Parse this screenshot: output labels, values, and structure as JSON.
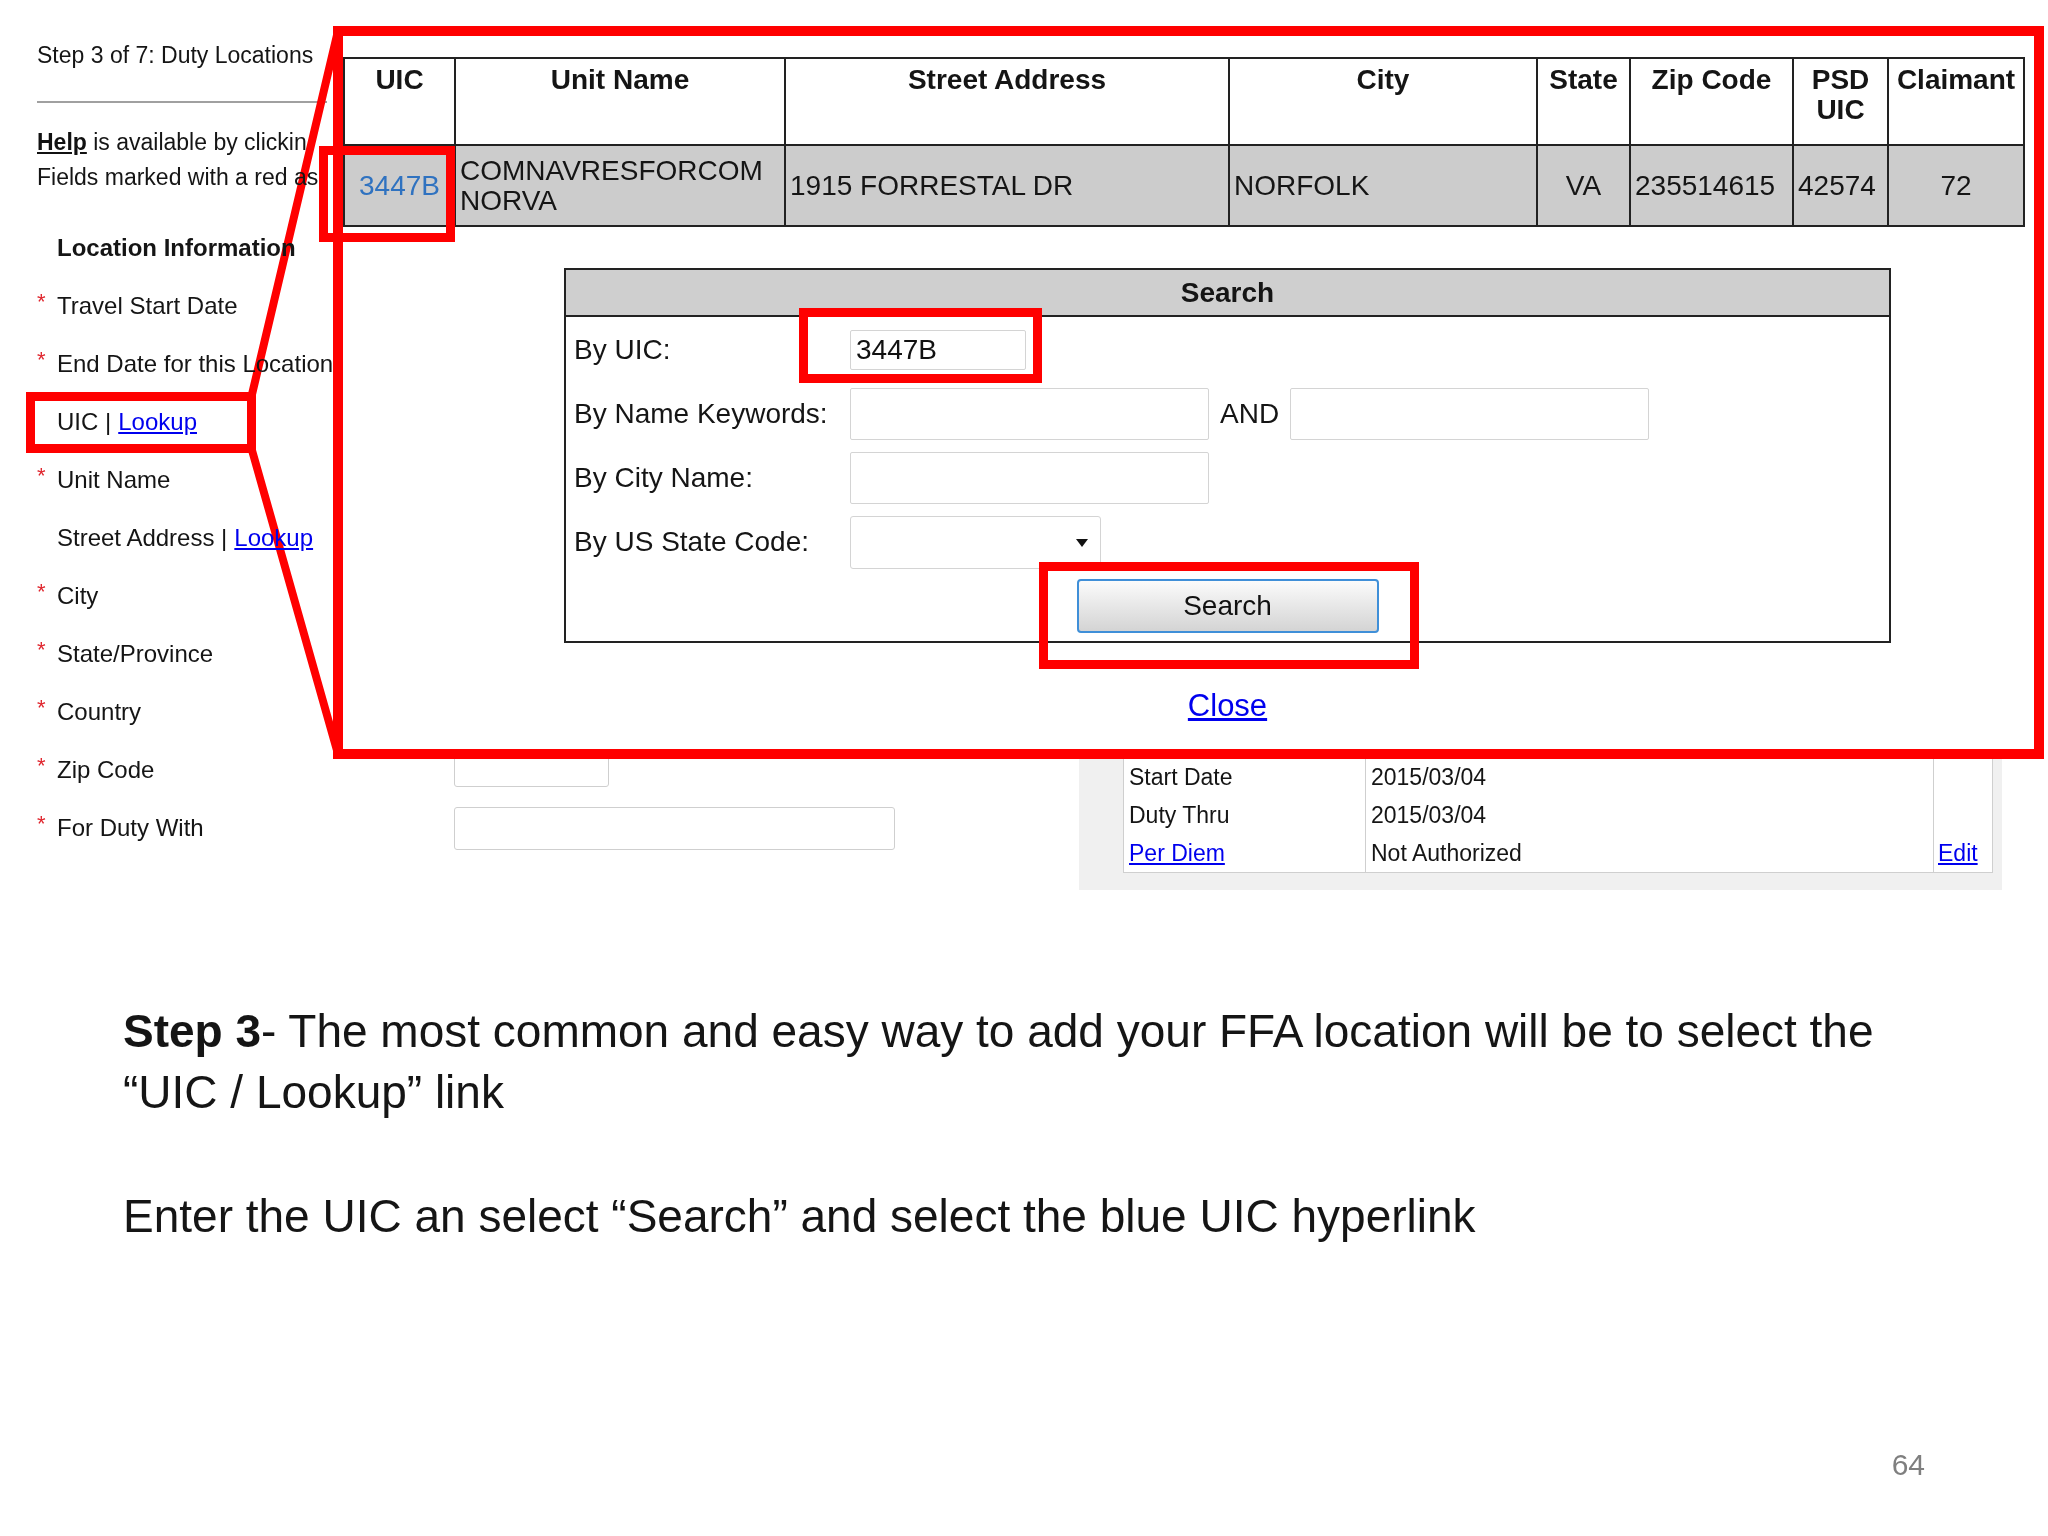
{
  "screenshot": {
    "page": {
      "step_title": "Step 3 of 7: Duty Locations",
      "help": {
        "link": "Help",
        "text": "is available by clickin"
      },
      "required_note": "Fields marked with a red as",
      "section_title": "Location Information",
      "fields": [
        {
          "label": "Travel Start Date",
          "marker": "*",
          "kind": "label",
          "highlighted": false
        },
        {
          "label": "End Date for this Location",
          "marker": "*",
          "kind": "label",
          "highlighted": false
        },
        {
          "label": "UIC |",
          "link": "Lookup",
          "kind": "label",
          "highlighted": true
        },
        {
          "label": "Unit Name",
          "marker": "*",
          "kind": "label",
          "highlighted": false
        },
        {
          "label": "Street Address |",
          "link": "Lookup",
          "kind": "label",
          "highlighted": false
        },
        {
          "label": "City",
          "marker": "*",
          "kind": "label",
          "highlighted": false
        },
        {
          "label": "State/Province",
          "marker": "*",
          "kind": "label",
          "highlighted": false
        },
        {
          "label": "Country",
          "marker": "*",
          "kind": "label",
          "highlighted": false
        },
        {
          "label": "Zip Code",
          "marker": "*",
          "kind": "short_input",
          "highlighted": false
        },
        {
          "label": "For Duty With",
          "marker": "*",
          "kind": "long_input",
          "highlighted": false
        }
      ],
      "details": {
        "rows": [
          {
            "label": "Start Date",
            "kind": "text",
            "value": "2015/03/04"
          },
          {
            "label": "Duty Thru",
            "kind": "text",
            "value": "2015/03/04"
          },
          {
            "label": "Per Diem",
            "kind": "link",
            "value": "Not Authorized",
            "action": "Edit"
          }
        ]
      }
    },
    "lookup_popup": {
      "results_table": {
        "columns": [
          "UIC",
          "Unit Name",
          "Street Address",
          "City",
          "State",
          "Zip Code",
          "PSD UIC",
          "Claimant"
        ],
        "rows": [
          {
            "cells": [
              {
                "text": "3447B",
                "kind": "link",
                "highlighted": true
              },
              {
                "text": "COMNAVRESFORCOM NORVA",
                "kind": "text",
                "highlighted": false
              },
              {
                "text": "1915 FORRESTAL DR",
                "kind": "text",
                "highlighted": false
              },
              {
                "text": "NORFOLK",
                "kind": "text",
                "highlighted": false
              },
              {
                "text": "VA",
                "kind": "text",
                "highlighted": false
              },
              {
                "text": "235514615",
                "kind": "text",
                "highlighted": false
              },
              {
                "text": "42574",
                "kind": "text",
                "highlighted": false
              },
              {
                "text": "72",
                "kind": "text",
                "highlighted": false
              }
            ]
          }
        ]
      },
      "search_panel": {
        "title": "Search",
        "rows": [
          {
            "label": "By UIC:",
            "kind": "short_text",
            "value": "3447B",
            "highlighted": true
          },
          {
            "label": "By Name Keywords:",
            "kind": "keywords",
            "joiner": "AND",
            "highlighted": false
          },
          {
            "label": "By City Name:",
            "kind": "text",
            "highlighted": false
          },
          {
            "label": "By US State Code:",
            "kind": "select",
            "highlighted": false
          }
        ],
        "button": {
          "label": "Search",
          "highlighted": true
        }
      },
      "close_link": "Close"
    }
  },
  "instructions": [
    "**Step 3**- The most common and easy way to add your FFA location will be to select the “UIC / Lookup” link",
    "Enter the UIC an select “Search” and select the blue UIC hyperlink"
  ],
  "page_number": "64"
}
